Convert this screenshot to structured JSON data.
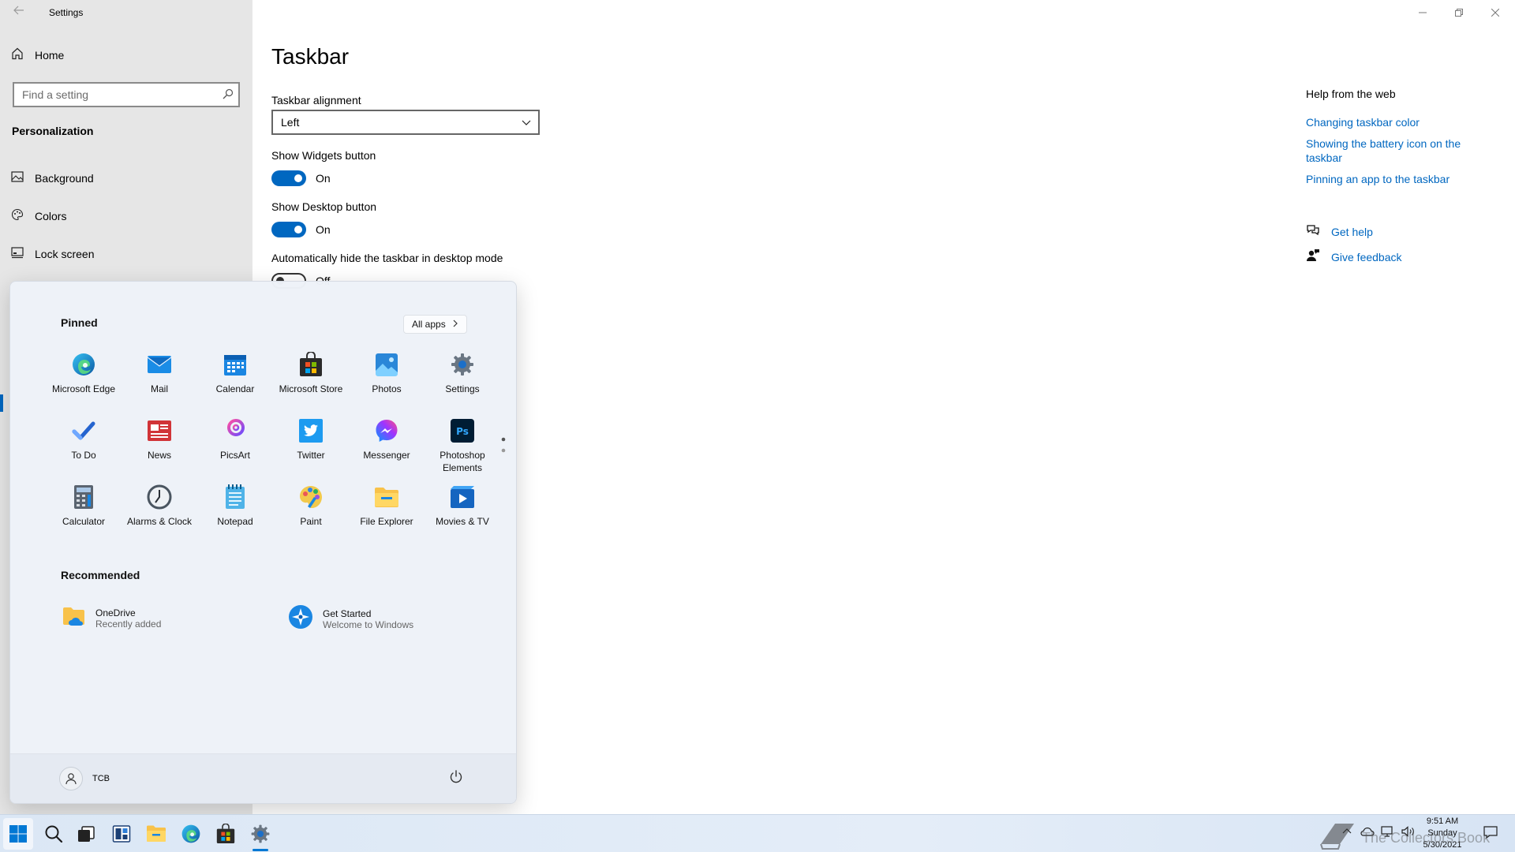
{
  "window": {
    "title": "Settings",
    "back_icon": "back-arrow-icon",
    "controls": [
      "minimize",
      "restore",
      "close"
    ]
  },
  "sidebar": {
    "home_label": "Home",
    "search_placeholder": "Find a setting",
    "section": "Personalization",
    "items": [
      {
        "label": "Background",
        "icon": "picture-icon"
      },
      {
        "label": "Colors",
        "icon": "palette-icon"
      },
      {
        "label": "Lock screen",
        "icon": "lock-screen-icon"
      }
    ]
  },
  "main": {
    "title": "Taskbar",
    "alignment_label": "Taskbar alignment",
    "alignment_value": "Left",
    "widgets_label": "Show Widgets button",
    "widgets_state": "On",
    "desktop_label": "Show Desktop button",
    "desktop_state": "On",
    "autohide_label": "Automatically hide the taskbar in desktop mode",
    "autohide_state": "Off"
  },
  "help": {
    "title": "Help from the web",
    "links": [
      "Changing taskbar color",
      "Showing the battery icon on the taskbar",
      "Pinning an app to the taskbar"
    ],
    "get_help": "Get help",
    "give_feedback": "Give feedback",
    "accent_color": "#0067c0"
  },
  "start_menu": {
    "pinned_label": "Pinned",
    "all_apps_label": "All apps",
    "pinned_apps": [
      {
        "label": "Microsoft Edge",
        "icon": "edge-icon"
      },
      {
        "label": "Mail",
        "icon": "mail-icon"
      },
      {
        "label": "Calendar",
        "icon": "calendar-icon"
      },
      {
        "label": "Microsoft Store",
        "icon": "store-icon"
      },
      {
        "label": "Photos",
        "icon": "photos-icon"
      },
      {
        "label": "Settings",
        "icon": "settings-gear-icon"
      },
      {
        "label": "To Do",
        "icon": "todo-icon"
      },
      {
        "label": "News",
        "icon": "news-icon"
      },
      {
        "label": "PicsArt",
        "icon": "picsart-icon"
      },
      {
        "label": "Twitter",
        "icon": "twitter-icon"
      },
      {
        "label": "Messenger",
        "icon": "messenger-icon"
      },
      {
        "label": "Photoshop Elements",
        "icon": "photoshop-icon"
      },
      {
        "label": "Calculator",
        "icon": "calculator-icon"
      },
      {
        "label": "Alarms & Clock",
        "icon": "clock-icon"
      },
      {
        "label": "Notepad",
        "icon": "notepad-icon"
      },
      {
        "label": "Paint",
        "icon": "paint-icon"
      },
      {
        "label": "File Explorer",
        "icon": "folder-icon"
      },
      {
        "label": "Movies & TV",
        "icon": "movies-icon"
      }
    ],
    "recommended_label": "Recommended",
    "recommended": [
      {
        "title": "OneDrive",
        "subtitle": "Recently added",
        "icon": "onedrive-folder-icon"
      },
      {
        "title": "Get Started",
        "subtitle": "Welcome to Windows",
        "icon": "get-started-icon"
      }
    ],
    "user_name": "TCB"
  },
  "taskbar": {
    "icons": [
      "windows-start-icon",
      "search-icon",
      "task-view-icon",
      "widgets-icon",
      "file-explorer-icon",
      "edge-icon",
      "store-icon",
      "settings-gear-icon"
    ],
    "time": "9:51 AM",
    "day": "Sunday",
    "date": "5/30/2021",
    "watermark": "The Collectors Book"
  }
}
